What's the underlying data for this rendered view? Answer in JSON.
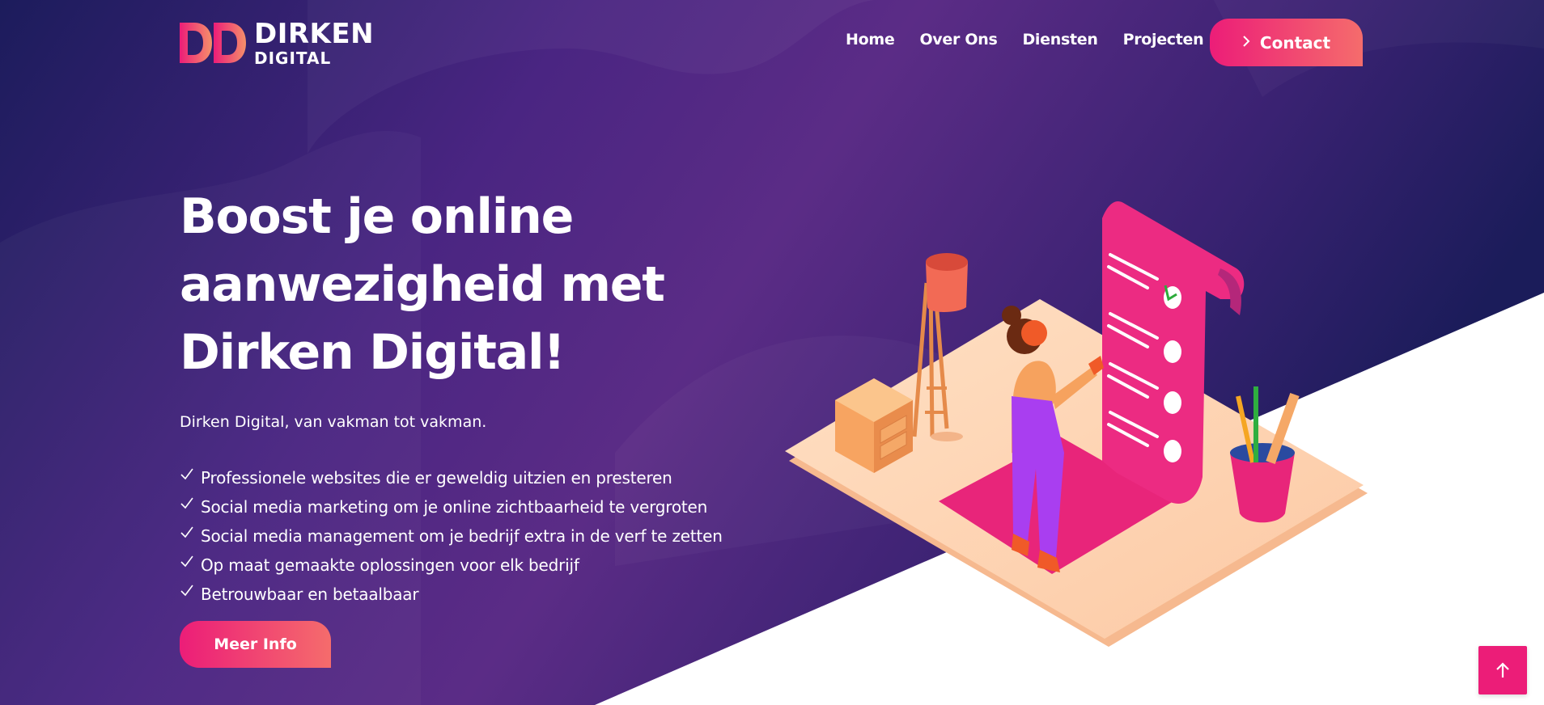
{
  "logo": {
    "line1": "DIRKEN",
    "line2": "DIGITAL"
  },
  "nav": {
    "items": [
      "Home",
      "Over Ons",
      "Diensten",
      "Projecten"
    ],
    "contact_label": "Contact"
  },
  "hero": {
    "title_lines": [
      "Boost je online",
      "aanwezigheid met",
      "Dirken Digital!"
    ],
    "subtitle": "Dirken Digital, van vakman tot vakman.",
    "bullets": [
      "Professionele websites die er geweldig uitzien en presteren",
      "Social media marketing om je online zichtbaarheid te vergroten",
      "Social media management om je bedrijf extra in de verf te zetten",
      "Op maat gemaakte oplossingen voor elk bedrijf",
      "Betrouwbaar en betaalbaar"
    ],
    "cta_label": "Meer Info"
  },
  "icons": {
    "check": "check-icon",
    "chevron": "chevron-right-icon",
    "scroll_top": "arrow-up-icon"
  },
  "colors": {
    "accent_pink": "#ec1d78",
    "accent_coral": "#f56c6c",
    "hero_dark": "#1e1b5e",
    "hero_purple": "#5b2c86"
  }
}
